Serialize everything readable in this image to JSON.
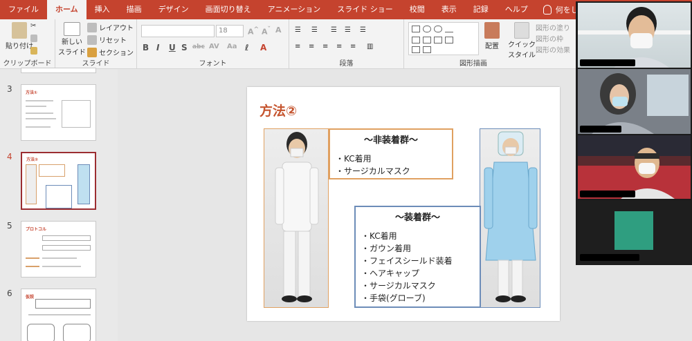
{
  "ribbon": {
    "tabs": [
      "ファイル",
      "ホーム",
      "挿入",
      "描画",
      "デザイン",
      "画面切り替え",
      "アニメーション",
      "スライド ショー",
      "校閲",
      "表示",
      "記録",
      "ヘルプ"
    ],
    "active_tab": "ホーム",
    "tell_me": "何をしますか",
    "clipboard": {
      "paste": "貼り付け",
      "label": "クリップボード"
    },
    "slides": {
      "new_slide_1": "新しい",
      "new_slide_2": "スライド",
      "layout": "レイアウト",
      "reset": "リセット",
      "section": "セクション",
      "label": "スライド"
    },
    "font": {
      "size": "18",
      "label": "フォント"
    },
    "paragraph": {
      "label": "段落"
    },
    "drawing": {
      "arrange": "配置",
      "quick_style_1": "クイック",
      "quick_style_2": "スタイル",
      "shape_fill": "図形の塗り",
      "shape_outline": "図形の枠",
      "shape_effects": "図形の効果",
      "label": "図形描画"
    }
  },
  "thumbnails": [
    {
      "number": "3",
      "title": "方法①"
    },
    {
      "number": "4",
      "title": "方法②",
      "selected": true
    },
    {
      "number": "5",
      "title": "プロトコル"
    },
    {
      "number": "6",
      "title": "仮説"
    }
  ],
  "slide": {
    "title": "方法②",
    "group_a": {
      "heading": "〜非装着群〜",
      "items": [
        "・KC着用",
        "・サージカルマスク"
      ]
    },
    "group_b": {
      "heading": "〜装着群〜",
      "items": [
        "・KC着用",
        "・ガウン着用",
        "・フェイスシールド装着",
        "・ヘアキャップ",
        "・サージカルマスク",
        "・手袋(グローブ)"
      ]
    }
  },
  "colors": {
    "accent": "#c5432e",
    "orange_box": "#e0a060",
    "blue_box": "#6c8cb8",
    "avatar": "#2f9e80"
  }
}
